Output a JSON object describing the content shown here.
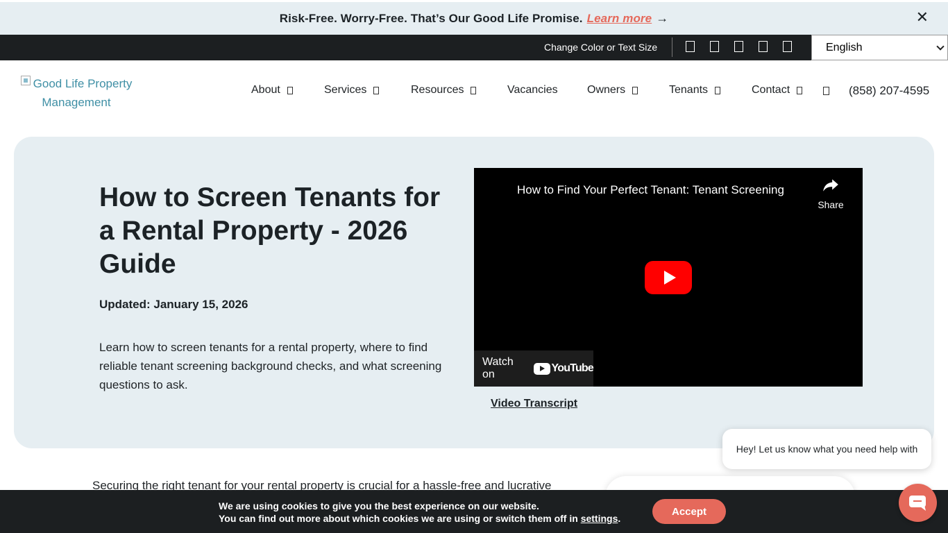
{
  "promo": {
    "text": "Risk-Free. Worry-Free. That’s Our Good Life Promise.",
    "link": "Learn more",
    "arrow": "→",
    "close": "✕"
  },
  "utility": {
    "label": "Change Color or Text Size",
    "language": "English"
  },
  "logo": {
    "alt_text": "Good Life Property Management"
  },
  "nav": {
    "items": [
      {
        "label": "About"
      },
      {
        "label": "Services"
      },
      {
        "label": "Resources"
      },
      {
        "label": "Vacancies"
      },
      {
        "label": "Owners"
      },
      {
        "label": "Tenants"
      },
      {
        "label": "Contact"
      }
    ],
    "phone": "(858) 207-4595"
  },
  "hero": {
    "title": "How to Screen Tenants for a Rental Property - 2026 Guide",
    "updated": "Updated: January 15, 2026",
    "description": "Learn how to screen tenants for a rental property, where to find reliable tenant screening background checks, and what screening questions to ask.",
    "transcript_link": "Video Transcript"
  },
  "video": {
    "title": "How to Find Your Perfect Tenant: Tenant Screening",
    "share": "Share",
    "watch_on": "Watch on",
    "youtube": "YouTube"
  },
  "body": {
    "first_line": "Securing the right tenant for your rental property is crucial for a hassle-free and lucrative"
  },
  "chat": {
    "bubble": "Hey! Let us know what you need help with"
  },
  "cookie": {
    "line1": "We are using cookies to give you the best experience on our website.",
    "line2": "You can find out more about which cookies we are using or switch them off in",
    "settings_link": "settings",
    "period": ".",
    "accept": "Accept"
  },
  "colors": {
    "accent": "#e5695b",
    "hero_bg": "#e6eef2",
    "dark_bar": "#1c1f21",
    "logo_text": "#3f8fa5"
  }
}
